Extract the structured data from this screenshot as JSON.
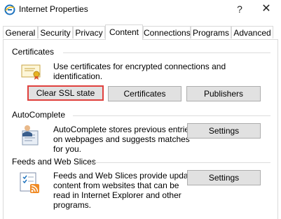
{
  "window": {
    "title": "Internet Properties",
    "help_glyph": "?",
    "close_glyph": "✕"
  },
  "tabs": [
    {
      "label": "General"
    },
    {
      "label": "Security"
    },
    {
      "label": "Privacy"
    },
    {
      "label": "Content"
    },
    {
      "label": "Connections"
    },
    {
      "label": "Programs"
    },
    {
      "label": "Advanced"
    }
  ],
  "active_tab": "Content",
  "certificates": {
    "heading": "Certificates",
    "description": "Use certificates for encrypted connections and identification.",
    "buttons": {
      "clear_ssl": "Clear SSL state",
      "certificates": "Certificates",
      "publishers": "Publishers"
    }
  },
  "autocomplete": {
    "heading": "AutoComplete",
    "description_lines": [
      "AutoComplete stores previous entries",
      "on webpages and suggests matches",
      "for you."
    ],
    "settings_label": "Settings"
  },
  "feeds": {
    "heading": "Feeds and Web Slices",
    "description_lines": [
      "Feeds and Web Slices provide updated",
      "content from websites that can be",
      "read in Internet Explorer and other",
      "programs."
    ],
    "settings_label": "Settings"
  },
  "colors": {
    "highlight": "#e0403d",
    "button_face": "#e1e1e1",
    "button_border": "#adadad",
    "ie_blue": "#1e73be",
    "rss_orange": "#f08a24"
  }
}
